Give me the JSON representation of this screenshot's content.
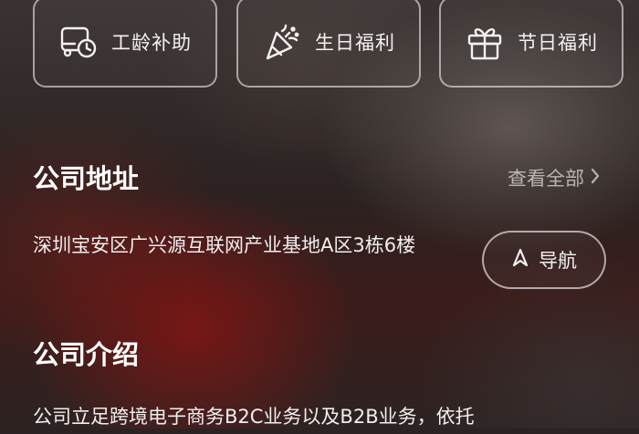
{
  "benefits": [
    {
      "label": "工龄补助",
      "icon": "clock-truck-icon"
    },
    {
      "label": "生日福利",
      "icon": "party-popper-icon"
    },
    {
      "label": "节日福利",
      "icon": "gift-icon"
    }
  ],
  "address_section": {
    "title": "公司地址",
    "view_all": "查看全部",
    "address": "深圳宝安区广兴源互联网产业基地A区3栋6楼",
    "nav_button": "导航"
  },
  "intro_section": {
    "title": "公司介绍",
    "text": "公司立足跨境电子商务B2C业务以及B2B业务，依托"
  }
}
